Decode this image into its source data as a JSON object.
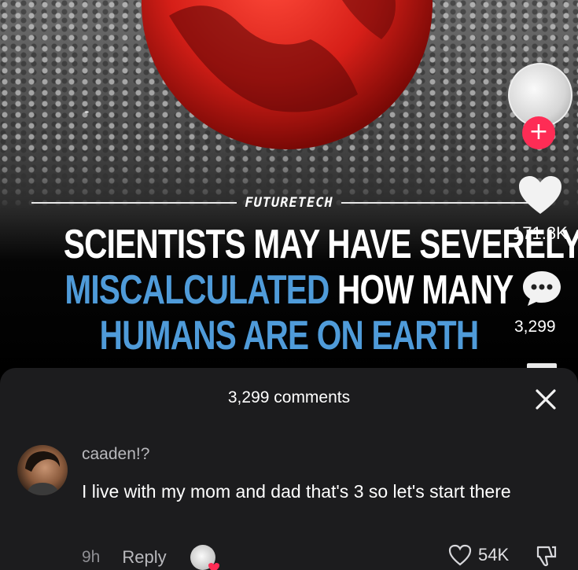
{
  "video": {
    "brand": "FUTURETECH",
    "headline": {
      "line1": "SCIENTISTS MAY HAVE SEVERELY",
      "line2_blue": "MISCALCULATED",
      "line2_white": "HOW MANY",
      "line3": "HUMANS ARE ON EARTH"
    },
    "colors": {
      "headline_white": "#ffffff",
      "headline_blue": "#4f9bd9",
      "globe": "#d91f1f",
      "follow": "#fe2c55"
    }
  },
  "sidebar": {
    "follow_icon": "plus-icon",
    "likes_count": "171.8K",
    "comments_count": "3,299"
  },
  "comments_sheet": {
    "title": "3,299 comments",
    "close_icon": "close-icon",
    "comment": {
      "username": "caaden!?",
      "text": "I live with my mom and dad that's 3 so let's start there",
      "time": "9h",
      "reply_label": "Reply",
      "likes": "54K",
      "like_icon": "heart-outline-icon",
      "dislike_icon": "thumbs-down-icon"
    }
  }
}
